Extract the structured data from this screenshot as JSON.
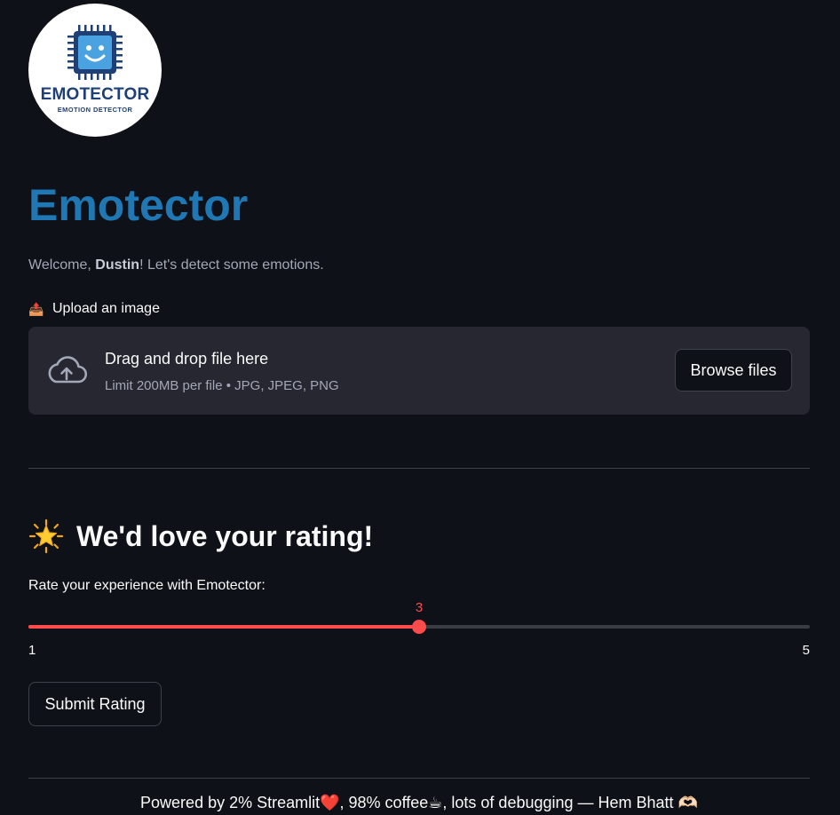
{
  "logo": {
    "wordmark": "EMOTECTOR",
    "tagline": "EMOTION DETECTOR"
  },
  "header": {
    "title": "Emotector"
  },
  "welcome": {
    "prefix": "Welcome, ",
    "name": "Dustin",
    "suffix": "! Let's detect some emotions."
  },
  "uploader": {
    "emoji": "📤",
    "label": "Upload an image",
    "drop_text": "Drag and drop file here",
    "limit_text": "Limit 200MB per file • JPG, JPEG, PNG",
    "browse_label": "Browse files"
  },
  "rating": {
    "heading": "We'd love your rating!",
    "label": "Rate your experience with Emotector:",
    "min": 1,
    "max": 5,
    "value": 3,
    "min_label": "1",
    "max_label": "5",
    "value_label": "3",
    "submit_label": "Submit Rating"
  },
  "footer": {
    "text": "Powered by 2% Streamlit❤️, 98% coffee☕, lots of debugging — Hem Bhatt 🫶🏻"
  },
  "colors": {
    "background": "#0e1117",
    "title": "#1f77b4",
    "accent": "#ff4b4b",
    "panel": "#262730"
  }
}
